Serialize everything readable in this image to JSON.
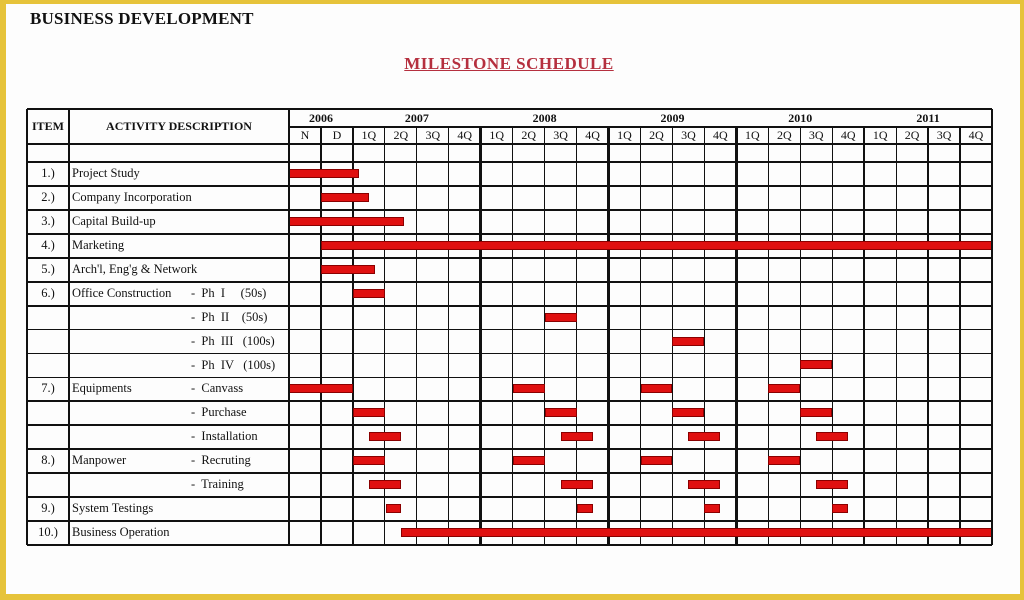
{
  "header": {
    "title": "BUSINESS DEVELOPMENT",
    "doc_title": "MILESTONE  SCHEDULE"
  },
  "table": {
    "col_item": "ITEM",
    "col_desc": "ACTIVITY DESCRIPTION",
    "years": [
      {
        "label": "2006",
        "periods": [
          "N",
          "D"
        ]
      },
      {
        "label": "2007",
        "periods": [
          "1Q",
          "2Q",
          "3Q",
          "4Q"
        ]
      },
      {
        "label": "2008",
        "periods": [
          "1Q",
          "2Q",
          "3Q",
          "4Q"
        ]
      },
      {
        "label": "2009",
        "periods": [
          "1Q",
          "2Q",
          "3Q",
          "4Q"
        ]
      },
      {
        "label": "2010",
        "periods": [
          "1Q",
          "2Q",
          "3Q",
          "4Q"
        ]
      },
      {
        "label": "2011",
        "periods": [
          "1Q",
          "2Q",
          "3Q",
          "4Q"
        ]
      }
    ],
    "bar_color": "#e01010",
    "rows": [
      {
        "item": "1.)",
        "activity": "Project Study",
        "sub": "",
        "bars": [
          [
            0,
            2.2
          ]
        ]
      },
      {
        "item": "2.)",
        "activity": "Company Incorporation",
        "sub": "",
        "bars": [
          [
            1,
            2.5
          ]
        ]
      },
      {
        "item": "3.)",
        "activity": "Capital Build-up",
        "sub": "",
        "bars": [
          [
            0,
            3.6
          ]
        ]
      },
      {
        "item": "4.)",
        "activity": "Marketing",
        "sub": "",
        "bars": [
          [
            1,
            22
          ]
        ]
      },
      {
        "item": "5.)",
        "activity": "Arch'l,  Eng'g  &  Network",
        "sub": "",
        "bars": [
          [
            1,
            2.7
          ]
        ]
      },
      {
        "item": "6.)",
        "activity": "Office Construction",
        "sub": "-  Ph  I     (50s)",
        "bars": [
          [
            2,
            3
          ]
        ]
      },
      {
        "item": "",
        "activity": "",
        "sub": "-  Ph  II    (50s)",
        "bars": [
          [
            8,
            9
          ]
        ]
      },
      {
        "item": "",
        "activity": "",
        "sub": "-  Ph  III   (100s)",
        "bars": [
          [
            12,
            13
          ]
        ]
      },
      {
        "item": "",
        "activity": "",
        "sub": "-  Ph  IV   (100s)",
        "bars": [
          [
            16,
            17
          ]
        ]
      },
      {
        "item": "7.)",
        "activity": "Equipments",
        "sub": "-  Canvass",
        "bars": [
          [
            0,
            2
          ],
          [
            7,
            8
          ],
          [
            11,
            12
          ],
          [
            15,
            16
          ]
        ]
      },
      {
        "item": "",
        "activity": "",
        "sub": "-  Purchase",
        "bars": [
          [
            2,
            3
          ],
          [
            8,
            9
          ],
          [
            12,
            13
          ],
          [
            16,
            17
          ]
        ]
      },
      {
        "item": "",
        "activity": "",
        "sub": "-  Installation",
        "bars": [
          [
            2.5,
            3.5
          ],
          [
            8.5,
            9.5
          ],
          [
            12.5,
            13.5
          ],
          [
            16.5,
            17.5
          ]
        ]
      },
      {
        "item": "8.)",
        "activity": "Manpower",
        "sub": "-  Recruting",
        "bars": [
          [
            2,
            3
          ],
          [
            7,
            8
          ],
          [
            11,
            12
          ],
          [
            15,
            16
          ]
        ]
      },
      {
        "item": "",
        "activity": "",
        "sub": "-  Training",
        "bars": [
          [
            2.5,
            3.5
          ],
          [
            8.5,
            9.5
          ],
          [
            12.5,
            13.5
          ],
          [
            16.5,
            17.5
          ]
        ]
      },
      {
        "item": "9.)",
        "activity": "System Testings",
        "sub": "",
        "bars": [
          [
            3.05,
            3.5
          ],
          [
            9,
            9.5
          ],
          [
            13,
            13.5
          ],
          [
            17,
            17.5
          ]
        ]
      },
      {
        "item": "10.)",
        "activity": "Business Operation",
        "sub": "",
        "bars": [
          [
            3.5,
            22
          ]
        ]
      }
    ]
  }
}
